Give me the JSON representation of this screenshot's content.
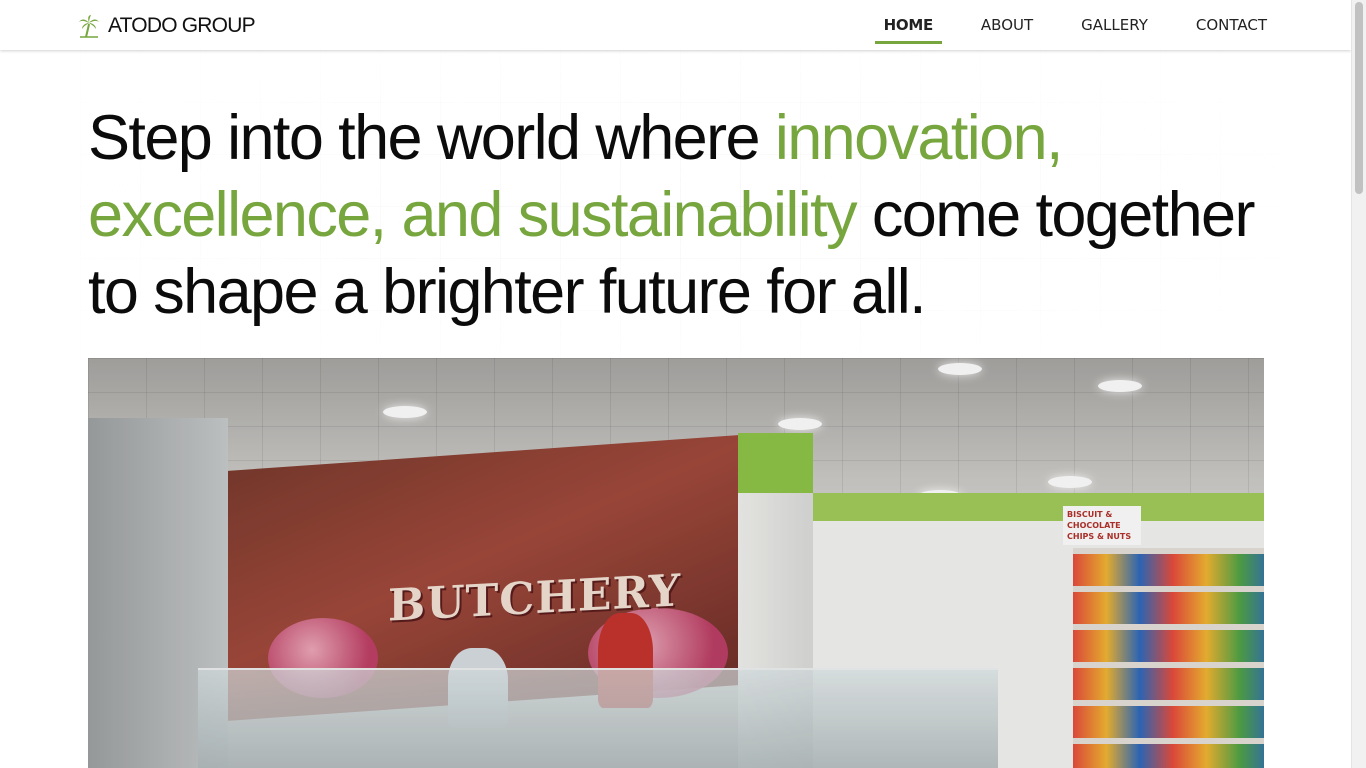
{
  "brand": {
    "name": "ATODO GROUP",
    "logo_icon": "palm-tree-icon",
    "accent_color": "#76a63d"
  },
  "nav": {
    "items": [
      {
        "label": "HOME",
        "active": true
      },
      {
        "label": "ABOUT",
        "active": false
      },
      {
        "label": "GALLERY",
        "active": false
      },
      {
        "label": "CONTACT",
        "active": false
      }
    ]
  },
  "hero": {
    "headline_start": "Step into the world where ",
    "headline_accent": "innovation, excellence, and sustainability",
    "headline_end": " come together to shape a brighter future for all.",
    "image_signs": {
      "butchery": "BUTCHERY",
      "shelf_line1": "BISCUIT & CHOCOLATE",
      "shelf_line2": "CHIPS & NUTS"
    }
  }
}
